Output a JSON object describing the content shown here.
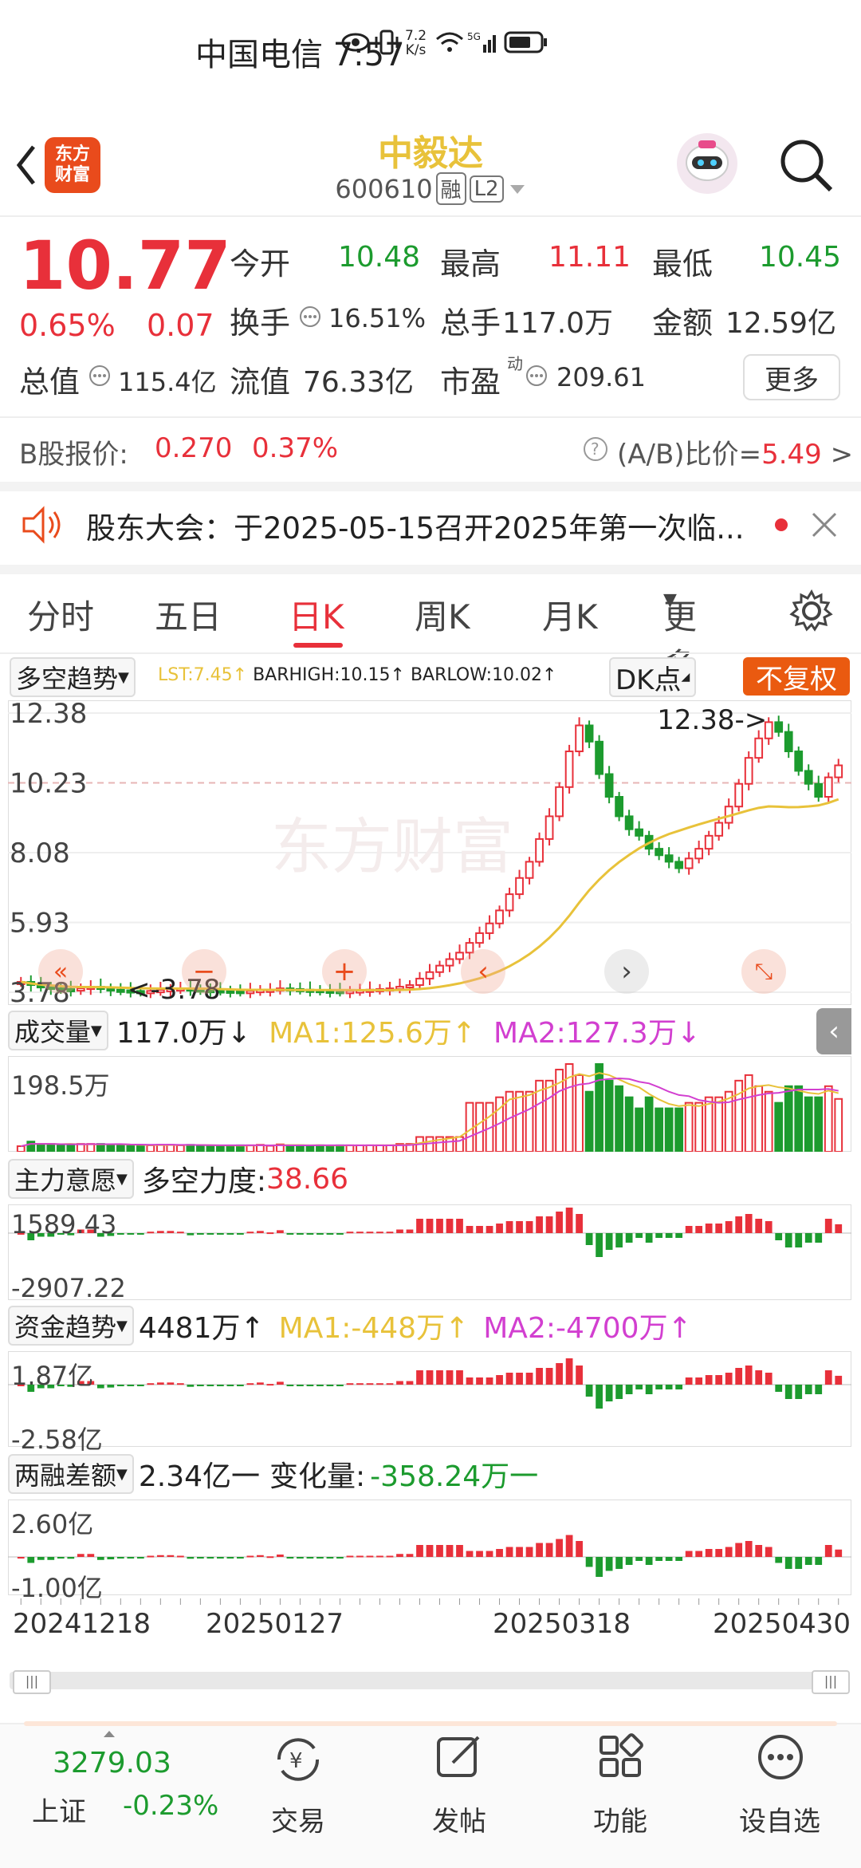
{
  "status": {
    "carrier": "中国电信",
    "time": "7:57",
    "net_speed_top": "7.2",
    "net_speed_bottom": "K/s",
    "network": "5G"
  },
  "header": {
    "stock_name": "中毅达",
    "code": "600610",
    "badge_rong": "融",
    "badge_l2": "L2",
    "logo_line1": "东方",
    "logo_line2": "财富"
  },
  "quote": {
    "price": "10.77",
    "change_pct": "0.65%",
    "change": "0.07",
    "open_label": "今开",
    "open": "10.48",
    "high_label": "最高",
    "high": "11.11",
    "low_label": "最低",
    "low": "10.45",
    "turnover_label": "换手",
    "turnover": "16.51%",
    "volume_label": "总手",
    "volume": "117.0万",
    "amount_label": "金额",
    "amount": "12.59亿",
    "mktcap_label": "总值",
    "mktcap": "115.4亿",
    "float_label": "流值",
    "float": "76.33亿",
    "pe_label": "市盈",
    "pe_sup": "动",
    "pe": "209.61",
    "more": "更多"
  },
  "bshare": {
    "label": "B股报价:",
    "price": "0.270",
    "pct": "0.37%",
    "ratio_label": "(A/B)比价=",
    "ratio": "5.49"
  },
  "notice": {
    "text": "股东大会：于2025-05-15召开2025年第一次临..."
  },
  "tabs": [
    "分时",
    "五日",
    "日K",
    "周K",
    "月K",
    "更多"
  ],
  "active_tab": 2,
  "kline": {
    "indicator": "多空趋势",
    "lst": "LST:7.45↑",
    "barhigh": "BARHIGH:10.15↑",
    "barlow": "BARLOW:10.02↑",
    "dk_btn": "DK点",
    "fq_btn": "不复权",
    "y_ticks": [
      "12.38",
      "10.23",
      "8.08",
      "5.93",
      "3.78"
    ],
    "max_label": "12.38->",
    "min_label": "<-3.78",
    "watermark": "东方财富"
  },
  "volume_panel": {
    "name": "成交量",
    "value": "117.0万↓",
    "ma1": "MA1:125.6万↑",
    "ma2": "MA2:127.3万↓",
    "top": "198.5万"
  },
  "force_panel": {
    "name": "主力意愿",
    "label": "多空力度:",
    "value": "38.66",
    "top": "1589.43",
    "bottom": "-2907.22"
  },
  "fund_panel": {
    "name": "资金趋势",
    "value": "4481万↑",
    "ma1": "MA1:-448万↑",
    "ma2": "MA2:-4700万↑",
    "top": "1.87亿",
    "bottom": "-2.58亿"
  },
  "margin_panel": {
    "name": "两融差额",
    "value": "2.34亿一",
    "change_label": "变化量:",
    "change": "-358.24万一",
    "top": "2.60亿",
    "bottom": "-1.00亿"
  },
  "dates": [
    "20241218",
    "20250127",
    "20250318",
    "20250430"
  ],
  "bottom": {
    "index_value": "3279.03",
    "index_name": "上证",
    "index_pct": "-0.23%",
    "nav": [
      "交易",
      "发帖",
      "功能",
      "设自选"
    ]
  },
  "colors": {
    "up": "#e8303a",
    "down": "#1c9b2e",
    "brand": "#e94b1c",
    "title": "#e8c23a",
    "ma1": "#e8c23a",
    "ma2": "#d23fd0"
  },
  "chart_data": {
    "type": "candlestick",
    "title": "",
    "xlabel": "",
    "ylabel": "",
    "x_ticks": [
      "20241218",
      "20250127",
      "20250318",
      "20250430"
    ],
    "ylim": [
      3.78,
      12.38
    ],
    "close": [
      4.1,
      4.0,
      3.95,
      3.9,
      3.88,
      3.85,
      3.9,
      3.95,
      3.9,
      3.86,
      3.84,
      3.82,
      3.8,
      3.82,
      3.85,
      3.88,
      3.9,
      3.87,
      3.85,
      3.84,
      3.83,
      3.82,
      3.8,
      3.82,
      3.85,
      3.86,
      3.9,
      3.88,
      3.86,
      3.85,
      3.83,
      3.82,
      3.8,
      3.82,
      3.84,
      3.86,
      3.88,
      3.9,
      3.95,
      4.0,
      4.2,
      4.4,
      4.6,
      4.8,
      5.0,
      5.3,
      5.6,
      5.9,
      6.3,
      6.8,
      7.3,
      7.8,
      8.5,
      9.2,
      10.1,
      11.2,
      12.0,
      11.5,
      10.5,
      9.8,
      9.2,
      8.8,
      8.6,
      8.2,
      8.0,
      7.8,
      7.6,
      7.9,
      8.2,
      8.6,
      9.0,
      9.5,
      10.2,
      11.0,
      11.6,
      12.1,
      11.8,
      11.2,
      10.6,
      10.2,
      9.8,
      10.4,
      10.77
    ]
  }
}
